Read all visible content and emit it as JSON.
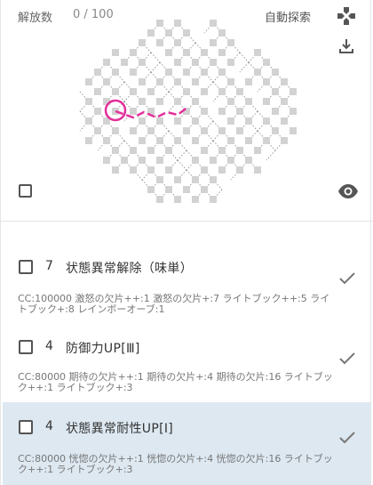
{
  "header": {
    "unlock_label": "解放数",
    "unlock_count": "0 / 100",
    "auto_explore_label": "自動探索"
  },
  "icons": {
    "gamepad": "gamepad-icon",
    "download": "download-icon",
    "eye": "eye-icon",
    "check": "check-icon"
  },
  "colors": {
    "path_highlight": "#e3309a",
    "node": "#d2d2d2",
    "selected_row": "#dde8f1"
  },
  "skills": [
    {
      "level": "7",
      "name": "状態異常解除（味単）",
      "cost": "CC:100000 激怒の欠片++:1 激怒の欠片+:7 ライトブック++:5 ライトブック+:8 レインボーオーブ:1",
      "selected": false
    },
    {
      "level": "4",
      "name": "防御力UP[Ⅲ]",
      "cost": "CC:80000 期待の欠片++:1 期待の欠片+:4 期待の欠片:16 ライトブック++:1 ライトブック+:3",
      "selected": false
    },
    {
      "level": "4",
      "name": "状態異常耐性UP[Ⅰ]",
      "cost": "CC:80000 恍惚の欠片++:1 恍惚の欠片+:4 恍惚の欠片:16 ライトブック++:1 ライトブック+:3",
      "selected": true
    }
  ]
}
